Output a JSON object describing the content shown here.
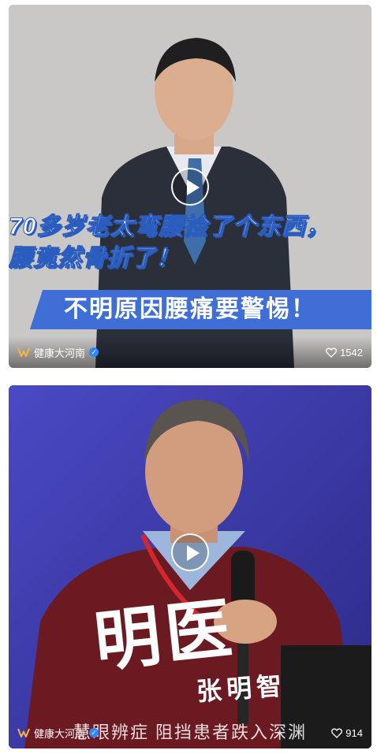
{
  "videos": [
    {
      "overlay_lines": [
        "70多岁老太弯腰捡了个东西，",
        "腰竟然骨折了！"
      ],
      "banner": "不明原因腰痛要警惕！",
      "author": "健康大河南",
      "likes": "1542"
    },
    {
      "calligraphy_main": "明医",
      "calligraphy_name": "张明智",
      "bottom_caption": "慧眼辨症 阻挡患者跌入深渊",
      "author": "健康大河南",
      "likes": "914"
    }
  ],
  "colors": {
    "verified": "#2f88ff",
    "caption_blue": "#3f6fd6",
    "card2_bg": "#3e3ba8"
  },
  "icons": [
    "play-icon",
    "author-logo-icon",
    "verified-icon",
    "heart-icon"
  ]
}
